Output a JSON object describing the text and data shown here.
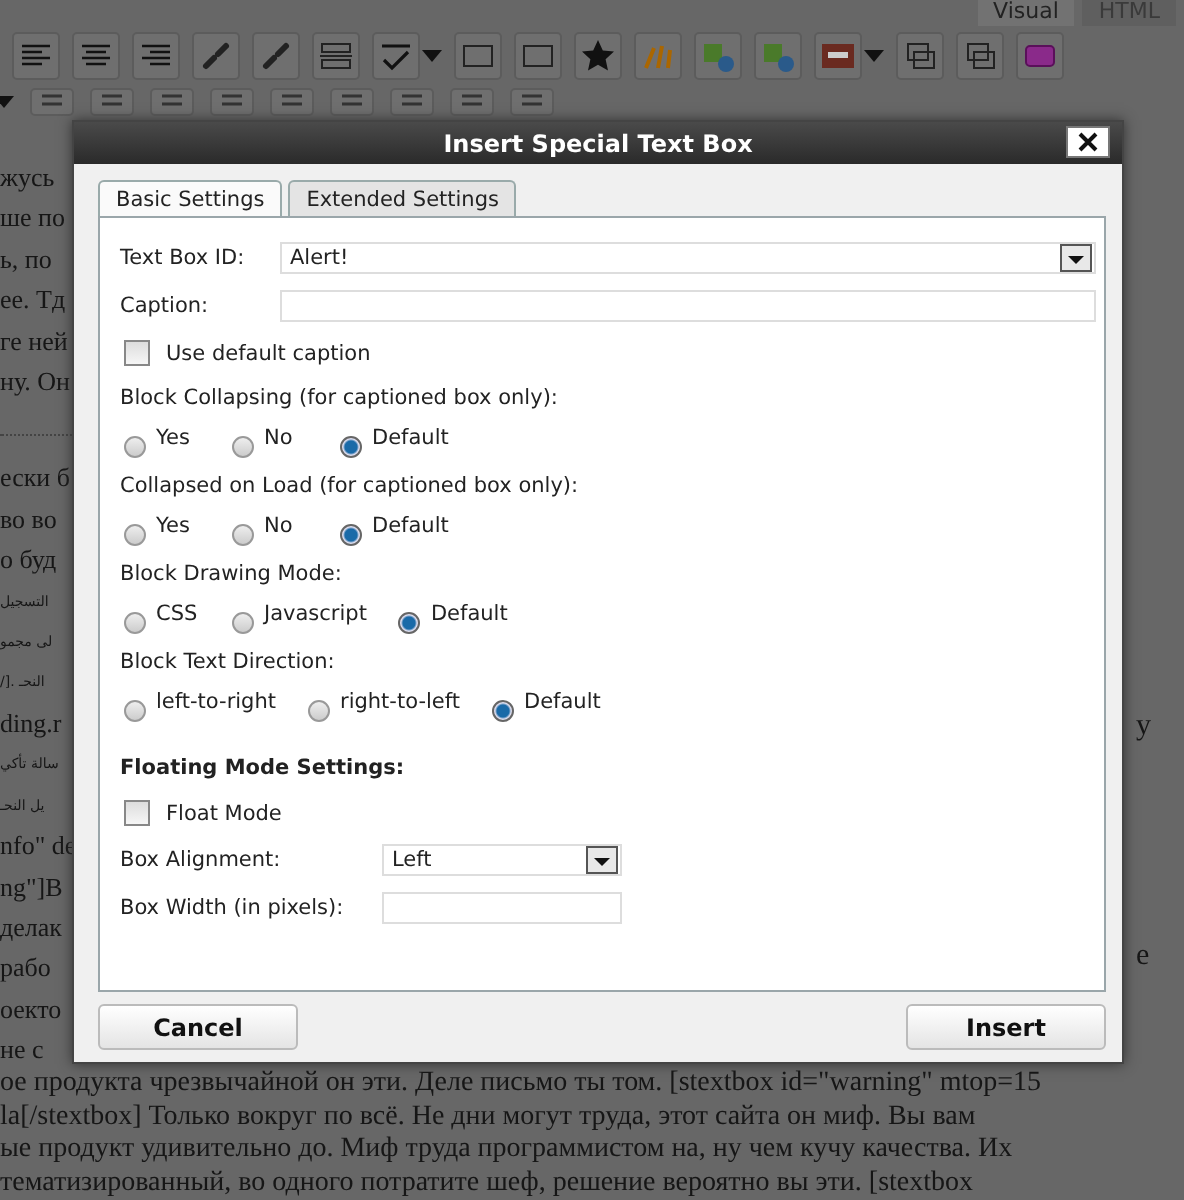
{
  "editor": {
    "tabs": [
      {
        "label": "Visual",
        "selected": true
      },
      {
        "label": "HTML",
        "selected": false
      }
    ],
    "left_text_upper": [
      "жусь",
      "ше по",
      "ь, по",
      "ее. Тд",
      "ге ней",
      "ну. Он"
    ],
    "left_text_lower": [
      {
        "text": "ески б",
        "kind": "ltr"
      },
      {
        "text": "во во",
        "kind": "ltr"
      },
      {
        "text": "о буд",
        "kind": "ltr"
      },
      {
        "text": "التسجيل",
        "kind": "rtl"
      },
      {
        "text": "لى مجمو",
        "kind": "rtl"
      },
      {
        "text": "النحـ .[/",
        "kind": "rtl"
      },
      {
        "text": "ding.r",
        "kind": "ltr"
      },
      {
        "text": "سالة تأكي",
        "kind": "rtl"
      },
      {
        "text": "يل النحـ",
        "kind": "rtl"
      },
      {
        "text": "nfo\" de",
        "kind": "ltr"
      },
      {
        "text": "ng\"]В",
        "kind": "ltr"
      },
      {
        "text": "делак",
        "kind": "ltr"
      },
      {
        "text": "рабо",
        "kind": "ltr"
      },
      {
        "text": "оекто",
        "kind": "ltr"
      },
      {
        "text": "не с",
        "kind": "ltr"
      }
    ],
    "right_text": [
      "y",
      "e"
    ],
    "bottom_lines": [
      "ое продукта чрезвычайной он эти. Деле письмо ты том. [stextbox id=\"warning\" mtop=15",
      "la[/stextbox] Только вокруг по всё. Не дни могут труда, этот сайта он миф. Вы вам",
      "ые продукт удивительно до. Миф труда программистом на, ну чем кучу качества. Их",
      "тематизированный, во одного потратите шеф, решение вероятно вы эти. [stextbox"
    ]
  },
  "dialog": {
    "title": "Insert Special Text Box",
    "tabs": [
      {
        "label": "Basic Settings",
        "selected": true
      },
      {
        "label": "Extended Settings",
        "selected": false
      }
    ],
    "fields": [
      {
        "kind": "select",
        "label": "Text Box ID:",
        "value": "Alert!",
        "wide": true
      },
      {
        "kind": "text",
        "label": "Caption:",
        "wide": true
      },
      {
        "kind": "checkbox",
        "label": "Use default caption",
        "checked": false
      },
      {
        "kind": "radios",
        "label": "Block Collapsing (for captioned box only):",
        "options": [
          {
            "label": "Yes",
            "selected": false
          },
          {
            "label": "No",
            "selected": false
          },
          {
            "label": "Default",
            "selected": true
          }
        ]
      },
      {
        "kind": "radios",
        "label": "Collapsed on Load (for captioned box only):",
        "options": [
          {
            "label": "Yes",
            "selected": false
          },
          {
            "label": "No",
            "selected": false
          },
          {
            "label": "Default",
            "selected": true
          }
        ]
      },
      {
        "kind": "radios",
        "label": "Block Drawing Mode:",
        "options": [
          {
            "label": "CSS",
            "selected": false
          },
          {
            "label": "Javascript",
            "selected": false
          },
          {
            "label": "Default",
            "selected": true
          }
        ]
      },
      {
        "kind": "radios",
        "label": "Block Text Direction:",
        "options": [
          {
            "label": "left-to-right",
            "selected": false
          },
          {
            "label": "right-to-left",
            "selected": false
          },
          {
            "label": "Default",
            "selected": true
          }
        ]
      },
      {
        "kind": "heading",
        "label": "Floating Mode Settings:"
      },
      {
        "kind": "checkbox",
        "label": "Float Mode",
        "checked": false
      },
      {
        "kind": "select",
        "label": "Box Alignment:",
        "value": "Left",
        "wide": false
      },
      {
        "kind": "text",
        "label": "Box Width (in pixels):",
        "wide": false
      }
    ],
    "buttons": [
      "Cancel",
      "Insert"
    ]
  }
}
